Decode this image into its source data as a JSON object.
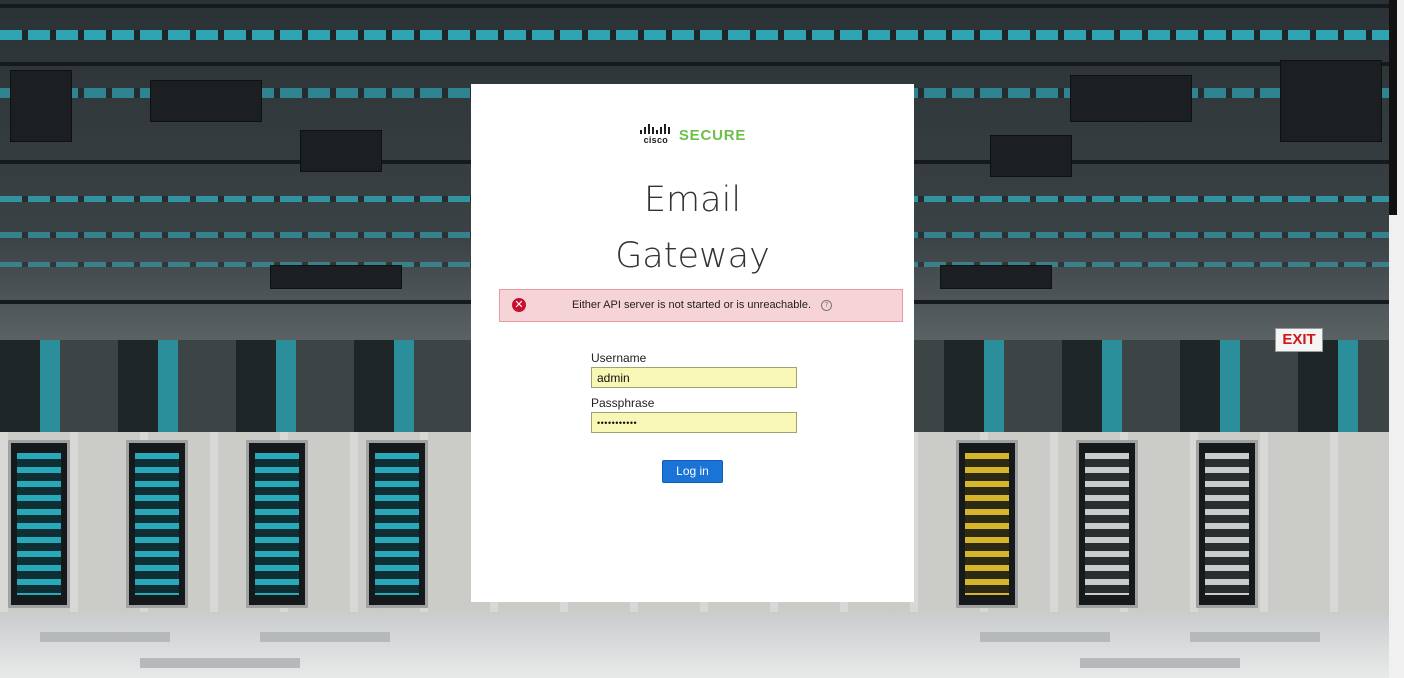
{
  "brand": {
    "company": "cisco",
    "product_line": "SECURE",
    "accent_color": "#6cc04a"
  },
  "title": {
    "line1": "Email",
    "line2": "Gateway"
  },
  "error": {
    "message": "Either API server is not started or is unreachable.",
    "icon": "error-x-icon",
    "help_icon": "help-icon",
    "help_glyph": "?",
    "error_glyph": "✕",
    "background_color": "#f6d3d7",
    "icon_color": "#c8102e"
  },
  "form": {
    "username_label": "Username",
    "username_value": "admin",
    "password_label": "Passphrase",
    "password_value": "•••••••••••",
    "input_background": "#f9f7b6"
  },
  "login_button": {
    "label": "Log in",
    "color": "#1a73d6"
  },
  "background": {
    "exit_sign": "EXIT"
  }
}
